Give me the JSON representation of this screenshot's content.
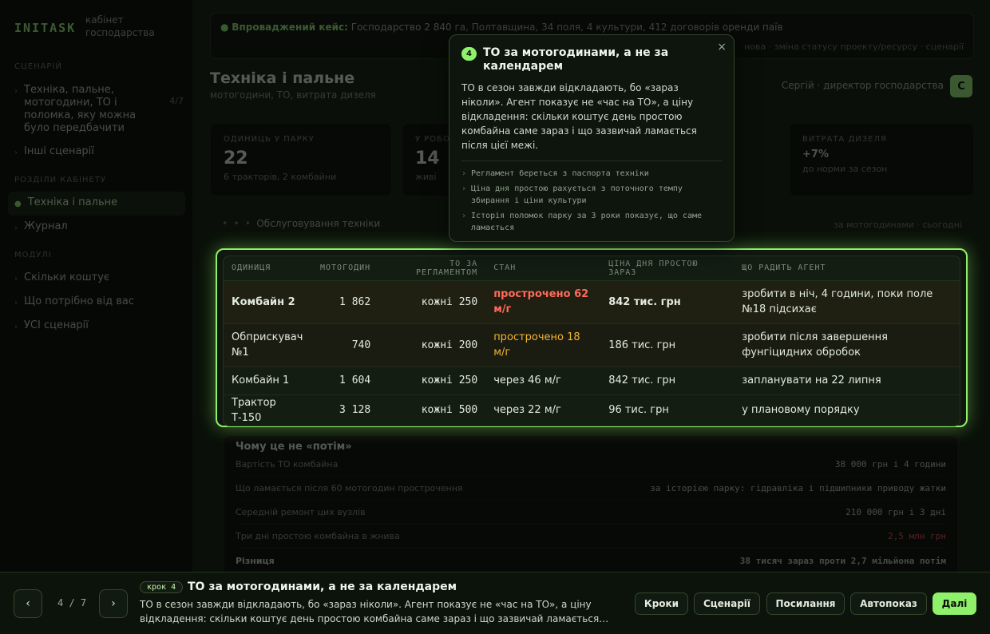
{
  "sidebar": {
    "logo": "INITASK",
    "logo_sub": "кабінет господарства",
    "section_scenario": "СЦЕНАРІЙ",
    "scenario_current": "Техніка, пальне, мотогодини, ТО і поломка, яку можна було передбачити",
    "scenario_count": "4/7",
    "other_scenarios": "Інші сценарії",
    "section_sections": "РОЗДІЛИ КАБІНЕТУ",
    "nav_active": "Техніка і пальне",
    "nav_journal": "Журнал",
    "section_modules": "МОДУЛІ",
    "modules": [
      "Скільки коштує",
      "Що потрібно від вас",
      "УСІ сценарії"
    ]
  },
  "banner": {
    "label": "Впроваджений кейс:",
    "text": "Господарство 2 840 га, Полтавщина, 34 поля, 4 культури, 412 договорів оренди паїв",
    "right": "нова · зміна статусу проекту/ресурсу · сценарії"
  },
  "header": {
    "title": "Техніка і пальне",
    "subtitle": "мотогодини, ТО, витрата дизеля",
    "user": "Сергій · директор господарства",
    "avatar": "С"
  },
  "kpis": [
    {
      "label": "ОДИНИЦЬ У ПАРКУ",
      "value": "22",
      "sub": "6 тракторів, 2 комбайни"
    },
    {
      "label": "У РОБОТІ",
      "value": "14",
      "sub": "живі"
    },
    {
      "label": "ВИТРАТА ДИЗЕЛЯ",
      "value": "+7%",
      "sub": "до норми за сезон"
    }
  ],
  "section": {
    "label": "Обслуговування техніки",
    "right": "за мотогодинами · сьогодні"
  },
  "table": {
    "headers": [
      "ОДИНИЦЯ",
      "МОТОГОДИН",
      "ТО ЗА РЕГЛАМЕНТОМ",
      "СТАН",
      "ЦІНА ДНЯ ПРОСТОЮ ЗАРАЗ",
      "ЩО РАДИТЬ АГЕНТ"
    ],
    "rows": [
      {
        "unit": "Комбайн 2",
        "hours": "1 862",
        "reg": "кожні 250",
        "status": "прострочено 62 м/г",
        "cost": "842 тис. грн",
        "advice": "зробити в ніч, 4 години, поки поле №18 підсихає"
      },
      {
        "unit": "Обприскувач №1",
        "hours": "740",
        "reg": "кожні 200",
        "status": "прострочено 18 м/г",
        "cost": "186 тис. грн",
        "advice": "зробити після завершення фунгіцидних обробок"
      },
      {
        "unit": "Комбайн 1",
        "hours": "1 604",
        "reg": "кожні 250",
        "status": "через 46 м/г",
        "cost": "842 тис. грн",
        "advice": "запланувати на 22 липня"
      },
      {
        "unit": "Трактор Т-150",
        "hours": "3 128",
        "reg": "кожні 500",
        "status": "через 22 м/г",
        "cost": "96 тис. грн",
        "advice": "у плановому порядку"
      }
    ]
  },
  "why": {
    "title": "Чому це не «потім»",
    "rows": [
      {
        "label": "Вартість ТО комбайна",
        "value": "38 000 грн і 4 години"
      },
      {
        "label": "Що ламається після 60 мотогодин прострочення",
        "value": "за історією парку: гідравліка і підшипники приводу жатки"
      },
      {
        "label": "Середній ремонт цих вузлів",
        "value": "210 000 грн і 3 дні"
      },
      {
        "label": "Три дні простою комбайна в жнива",
        "value": "2,5 млн грн"
      },
      {
        "label": "Різниця",
        "value": "38 тисяч зараз проти 2,7 мільйона потім"
      }
    ]
  },
  "popover": {
    "step": "4",
    "title": "ТО за мотогодинами, а не за календарем",
    "body": "ТО в сезон завжди відкладають, бо «зараз ніколи». Агент показує не «час на ТО», а ціну відкладення: скільки коштує день простою комбайна саме зараз і що зазвичай ламається після цієї межі.",
    "notes": [
      "Регламент береться з паспорта техніки",
      "Ціна дня простою рахується з поточного темпу збирання і ціни культури",
      "Історія поломок парку за 3 роки показує, що саме ламається"
    ],
    "close": "×"
  },
  "bottom": {
    "prev": "‹",
    "next": "›",
    "counter": "4 / 7",
    "step_badge": "крок 4",
    "title": "ТО за мотогодинами, а не за календарем",
    "text": "ТО в сезон завжди відкладають, бо «зараз ніколи». Агент показує не «час на ТО», а ціну відкладення: скільки коштує день простою комбайна саме зараз і що зазвичай ламається…",
    "buttons": {
      "steps": "Кроки",
      "scenarios": "Сценарії",
      "links": "Посилання",
      "autoplay": "Автопоказ",
      "next": "Далі"
    }
  },
  "colors": {
    "accent": "#8ff06a",
    "danger": "#ff6a5a",
    "warning": "#f0b430",
    "background": "#0a1009"
  }
}
